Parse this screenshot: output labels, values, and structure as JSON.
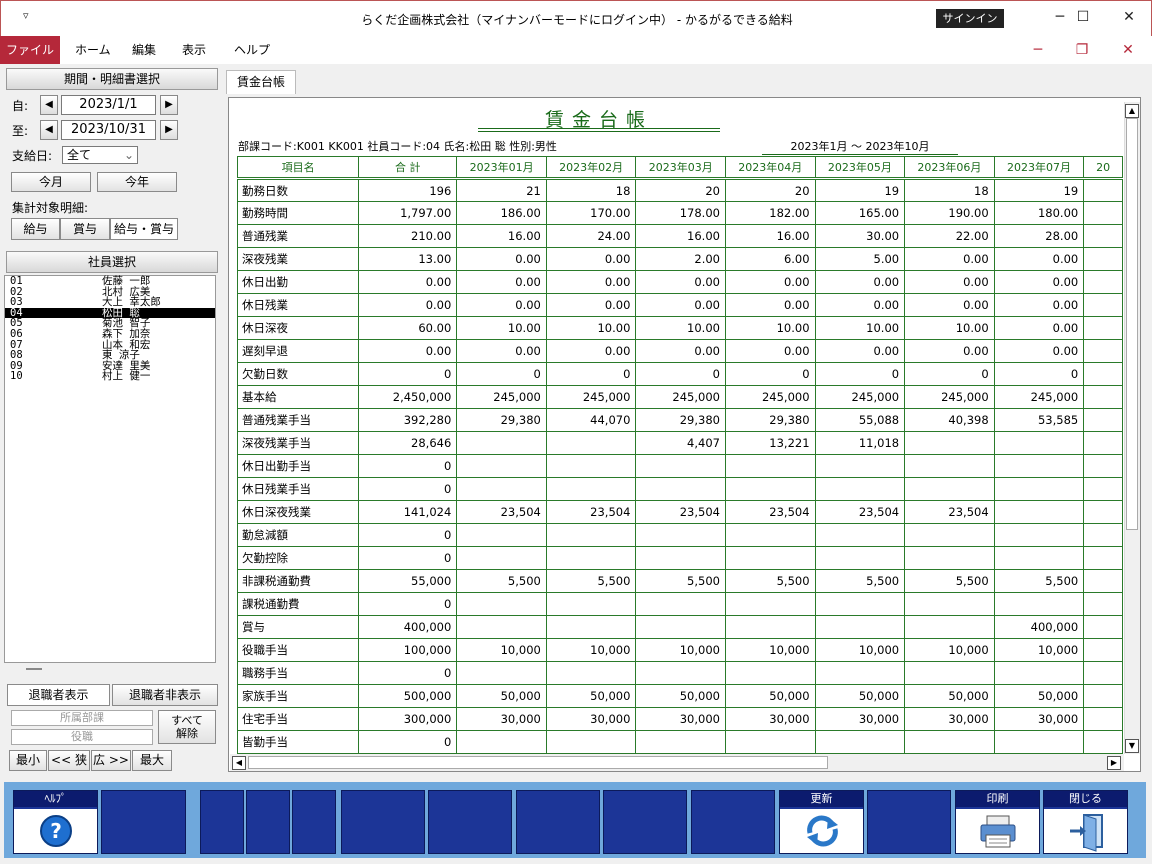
{
  "window": {
    "title": "らくだ企画株式会社（マイナンバーモードにログイン中） -  かるがるできる給料",
    "signin": "サインイン",
    "quick_access": "▿",
    "min": "─",
    "max": "☐",
    "close": "✕"
  },
  "menu": [
    "ファイル",
    "ホーム",
    "編集",
    "表示",
    "ヘルプ"
  ],
  "menu_window": {
    "min": "─",
    "restore": "❐",
    "close": "✕"
  },
  "left": {
    "period_header": "期間・明細書選択",
    "from_label": "自:",
    "from_date": "2023/1/1",
    "to_label": "至:",
    "to_date": "2023/10/31",
    "payday_label": "支給日:",
    "payday_value": "全て",
    "this_month": "今月",
    "this_year": "今年",
    "target_label": "集計対象明細:",
    "targets": [
      "給与",
      "賞与",
      "給与・賞与"
    ],
    "employee_header": "社員選択",
    "employees": [
      {
        "code": "01",
        "name": "佐藤 一郎"
      },
      {
        "code": "02",
        "name": "北村 広美"
      },
      {
        "code": "03",
        "name": "大上 幸太郎"
      },
      {
        "code": "04",
        "name": "松田 聡"
      },
      {
        "code": "05",
        "name": "菊池 智子"
      },
      {
        "code": "06",
        "name": "森下 加奈"
      },
      {
        "code": "07",
        "name": "山本 和宏"
      },
      {
        "code": "08",
        "name": "東 涼子"
      },
      {
        "code": "09",
        "name": "安達 里美"
      },
      {
        "code": "10",
        "name": "村上 健一"
      }
    ],
    "selected_index": 3,
    "show_retired": "退職者表示",
    "hide_retired": "退職者非表示",
    "dept_placeholder": "所属部課",
    "post_placeholder": "役職",
    "clear_all": "すべて\n解除",
    "zoom_buttons": [
      "最小",
      "<< 狭",
      "広 >>",
      "最大"
    ]
  },
  "tab": "賃金台帳",
  "sheet": {
    "title": "賃金台帳",
    "info": "部課コード:K001 KK001  社員コード:04  氏名:松田 聡  性別:男性",
    "period": "2023年1月 〜 2023年10月",
    "columns": [
      "項目名",
      "合 計",
      "2023年01月",
      "2023年02月",
      "2023年03月",
      "2023年04月",
      "2023年05月",
      "2023年06月",
      "2023年07月",
      "20"
    ],
    "rows": [
      [
        "勤務日数",
        "196",
        "21",
        "18",
        "20",
        "20",
        "19",
        "18",
        "19",
        ""
      ],
      [
        "勤務時間",
        "1,797.00",
        "186.00",
        "170.00",
        "178.00",
        "182.00",
        "165.00",
        "190.00",
        "180.00",
        ""
      ],
      [
        "普通残業",
        "210.00",
        "16.00",
        "24.00",
        "16.00",
        "16.00",
        "30.00",
        "22.00",
        "28.00",
        ""
      ],
      [
        "深夜残業",
        "13.00",
        "0.00",
        "0.00",
        "2.00",
        "6.00",
        "5.00",
        "0.00",
        "0.00",
        ""
      ],
      [
        "休日出勤",
        "0.00",
        "0.00",
        "0.00",
        "0.00",
        "0.00",
        "0.00",
        "0.00",
        "0.00",
        ""
      ],
      [
        "休日残業",
        "0.00",
        "0.00",
        "0.00",
        "0.00",
        "0.00",
        "0.00",
        "0.00",
        "0.00",
        ""
      ],
      [
        "休日深夜",
        "60.00",
        "10.00",
        "10.00",
        "10.00",
        "10.00",
        "10.00",
        "10.00",
        "0.00",
        ""
      ],
      [
        "遅刻早退",
        "0.00",
        "0.00",
        "0.00",
        "0.00",
        "0.00",
        "0.00",
        "0.00",
        "0.00",
        ""
      ],
      [
        "欠勤日数",
        "0",
        "0",
        "0",
        "0",
        "0",
        "0",
        "0",
        "0",
        ""
      ],
      [
        "基本給",
        "2,450,000",
        "245,000",
        "245,000",
        "245,000",
        "245,000",
        "245,000",
        "245,000",
        "245,000",
        ""
      ],
      [
        "普通残業手当",
        "392,280",
        "29,380",
        "44,070",
        "29,380",
        "29,380",
        "55,088",
        "40,398",
        "53,585",
        ""
      ],
      [
        "深夜残業手当",
        "28,646",
        "",
        "",
        "4,407",
        "13,221",
        "11,018",
        "",
        "",
        ""
      ],
      [
        "休日出勤手当",
        "0",
        "",
        "",
        "",
        "",
        "",
        "",
        "",
        ""
      ],
      [
        "休日残業手当",
        "0",
        "",
        "",
        "",
        "",
        "",
        "",
        "",
        ""
      ],
      [
        "休日深夜残業",
        "141,024",
        "23,504",
        "23,504",
        "23,504",
        "23,504",
        "23,504",
        "23,504",
        "",
        ""
      ],
      [
        "勤怠減額",
        "0",
        "",
        "",
        "",
        "",
        "",
        "",
        "",
        ""
      ],
      [
        "欠勤控除",
        "0",
        "",
        "",
        "",
        "",
        "",
        "",
        "",
        ""
      ],
      [
        "非課税通勤費",
        "55,000",
        "5,500",
        "5,500",
        "5,500",
        "5,500",
        "5,500",
        "5,500",
        "5,500",
        ""
      ],
      [
        "課税通勤費",
        "0",
        "",
        "",
        "",
        "",
        "",
        "",
        "",
        ""
      ],
      [
        "賞与",
        "400,000",
        "",
        "",
        "",
        "",
        "",
        "",
        "400,000",
        ""
      ],
      [
        "役職手当",
        "100,000",
        "10,000",
        "10,000",
        "10,000",
        "10,000",
        "10,000",
        "10,000",
        "10,000",
        ""
      ],
      [
        "職務手当",
        "0",
        "",
        "",
        "",
        "",
        "",
        "",
        "",
        ""
      ],
      [
        "家族手当",
        "500,000",
        "50,000",
        "50,000",
        "50,000",
        "50,000",
        "50,000",
        "50,000",
        "50,000",
        ""
      ],
      [
        "住宅手当",
        "300,000",
        "30,000",
        "30,000",
        "30,000",
        "30,000",
        "30,000",
        "30,000",
        "30,000",
        ""
      ],
      [
        "皆勤手当",
        "0",
        "",
        "",
        "",
        "",
        "",
        "",
        "",
        ""
      ]
    ]
  },
  "footer": {
    "help": "ﾍﾙﾌﾟ",
    "update": "更新",
    "print": "印刷",
    "close": "閉じる"
  }
}
